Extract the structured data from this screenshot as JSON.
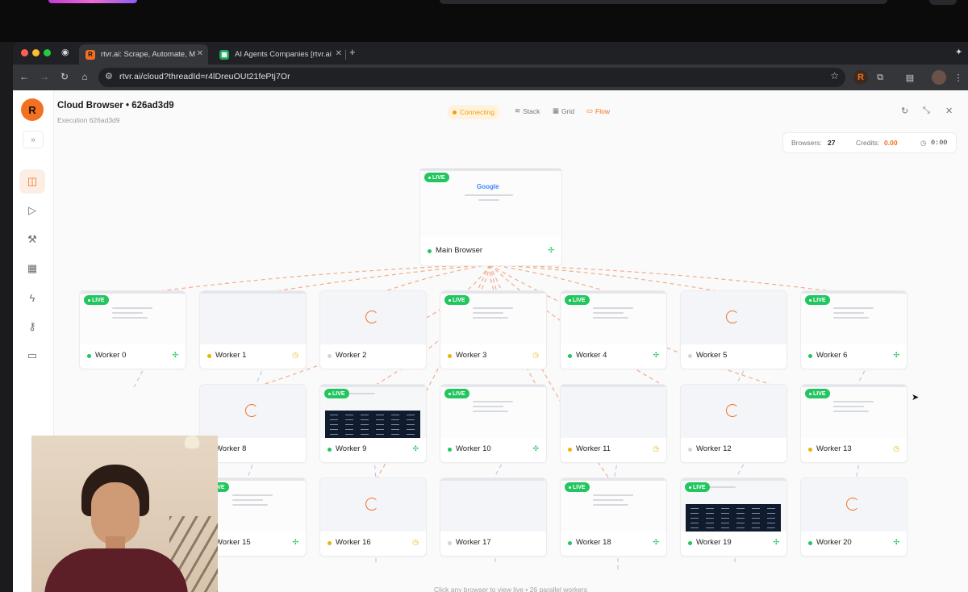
{
  "browser": {
    "tabs": [
      {
        "title": "rtvr.ai: Scrape, Automate, M",
        "active": true,
        "favicon_color": "#f37021",
        "favicon_icon": "rtvr-logo-icon"
      },
      {
        "title": "AI Agents Companies [rtvr.ai",
        "active": false,
        "favicon_color": "#1ea362",
        "favicon_icon": "sheets-icon"
      }
    ],
    "url": "rtvr.ai/cloud?threadId=r4lDreuOUt21fePtj7Or"
  },
  "app": {
    "logo_text": "R",
    "title": "Cloud Browser • 626ad3d9",
    "subtitle": "Execution 626ad3d9",
    "status": "Connecting",
    "views": [
      {
        "label": "Stack",
        "icon": "stack-icon",
        "active": false
      },
      {
        "label": "Grid",
        "icon": "grid-icon",
        "active": false
      },
      {
        "label": "Flow",
        "icon": "flow-icon",
        "active": true
      }
    ],
    "stats": {
      "browsers_label": "Browsers:",
      "browsers_value": "27",
      "credits_label": "Credits:",
      "credits_value": "0.00",
      "time_value": "0:00"
    },
    "rail_icons": [
      "bot-icon",
      "play-circle-icon",
      "wrench-icon",
      "calendar-icon",
      "bolt-icon",
      "key-icon",
      "card-icon"
    ],
    "hint": "Click any browser to view live • 26 parallel workers"
  },
  "main_browser": {
    "name": "Main Browser",
    "live_label": "LIVE",
    "google": "Google"
  },
  "workers": [
    {
      "name": "Worker 0",
      "status": "live",
      "thumb": "page"
    },
    {
      "name": "Worker 1",
      "status": "pending",
      "thumb": "blank"
    },
    {
      "name": "Worker 2",
      "status": "idle",
      "thumb": "spinner"
    },
    {
      "name": "Worker 3",
      "status": "pending",
      "thumb": "page",
      "live": true
    },
    {
      "name": "Worker 4",
      "status": "live",
      "thumb": "page"
    },
    {
      "name": "Worker 5",
      "status": "idle",
      "thumb": "spinner"
    },
    {
      "name": "Worker 6",
      "status": "live",
      "thumb": "white"
    },
    {
      "name": "Worker 8",
      "status": "idle",
      "thumb": "spinner"
    },
    {
      "name": "Worker 9",
      "status": "live",
      "thumb": "dark"
    },
    {
      "name": "Worker 10",
      "status": "live",
      "thumb": "page"
    },
    {
      "name": "Worker 11",
      "status": "pending",
      "thumb": "blank"
    },
    {
      "name": "Worker 12",
      "status": "idle",
      "thumb": "spinner"
    },
    {
      "name": "Worker 13",
      "status": "pending",
      "thumb": "page",
      "live": true
    },
    {
      "name": "Worker 15",
      "status": "live",
      "thumb": "page"
    },
    {
      "name": "Worker 16",
      "status": "pending",
      "thumb": "spinner"
    },
    {
      "name": "Worker 17",
      "status": "idle",
      "thumb": "blank"
    },
    {
      "name": "Worker 18",
      "status": "live",
      "thumb": "page"
    },
    {
      "name": "Worker 19",
      "status": "live",
      "thumb": "dark"
    },
    {
      "name": "Worker 20",
      "status": "live",
      "thumb": "spinner"
    }
  ],
  "live_label": "LIVE",
  "colors": {
    "accent": "#f37021",
    "live": "#22c55e",
    "pending": "#eab308",
    "idle": "#d4d4d8"
  }
}
